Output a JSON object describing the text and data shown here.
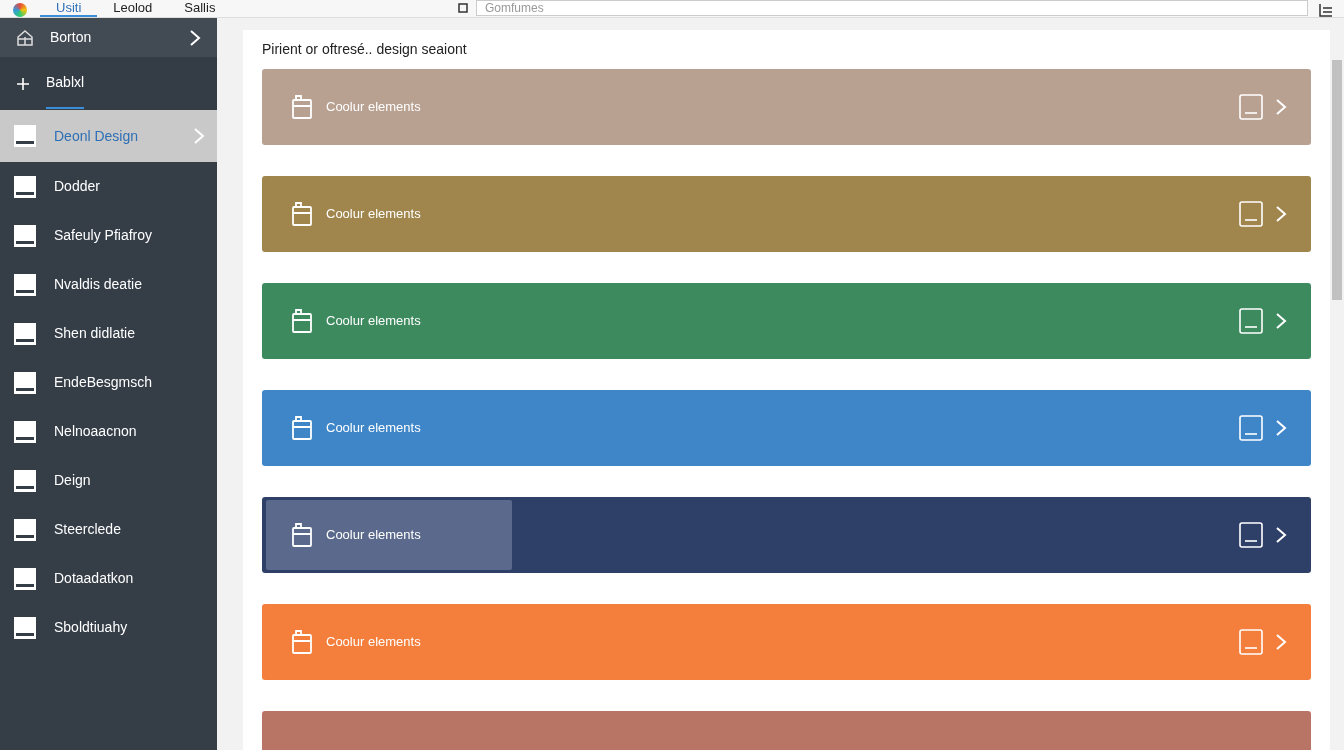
{
  "toolbar": {
    "tabs": [
      {
        "label": "Usiti",
        "selected": true
      },
      {
        "label": "Leolod",
        "selected": false
      },
      {
        "label": "Sallis",
        "selected": false
      }
    ],
    "search": {
      "placeholder": "Gomfumes"
    }
  },
  "sidebar": {
    "header": "Borton",
    "add_item": "Bablxl",
    "items": [
      {
        "label": "Deonl Design",
        "selected": true
      },
      {
        "label": "Dodder",
        "selected": false
      },
      {
        "label": "Safeuly Pfiafroy",
        "selected": false
      },
      {
        "label": "Nvaldis deatie",
        "selected": false
      },
      {
        "label": "Shen didlatie",
        "selected": false
      },
      {
        "label": "EndeBesgmsch",
        "selected": false
      },
      {
        "label": "Nelnoaacnon",
        "selected": false
      },
      {
        "label": "Deign",
        "selected": false
      },
      {
        "label": "Steerclede",
        "selected": false
      },
      {
        "label": "Dotaadatkon",
        "selected": false
      },
      {
        "label": "Sboldtiuahy",
        "selected": false
      }
    ]
  },
  "main": {
    "heading": "Pirient or oftresé.. design seaiont",
    "cards": [
      {
        "label": "Coolur elements",
        "color": "#b9a191",
        "selected": false
      },
      {
        "label": "Coolur elements",
        "color": "#a0864d",
        "selected": false
      },
      {
        "label": "Coolur elements",
        "color": "#3e8a5f",
        "selected": false
      },
      {
        "label": "Coolur elements",
        "color": "#3f86c8",
        "selected": false
      },
      {
        "label": "Coolur elements",
        "color": "#2f4068",
        "selected": true
      },
      {
        "label": "Coolur elements",
        "color": "#f47f3c",
        "selected": false
      },
      {
        "color": "#b87465"
      }
    ]
  }
}
